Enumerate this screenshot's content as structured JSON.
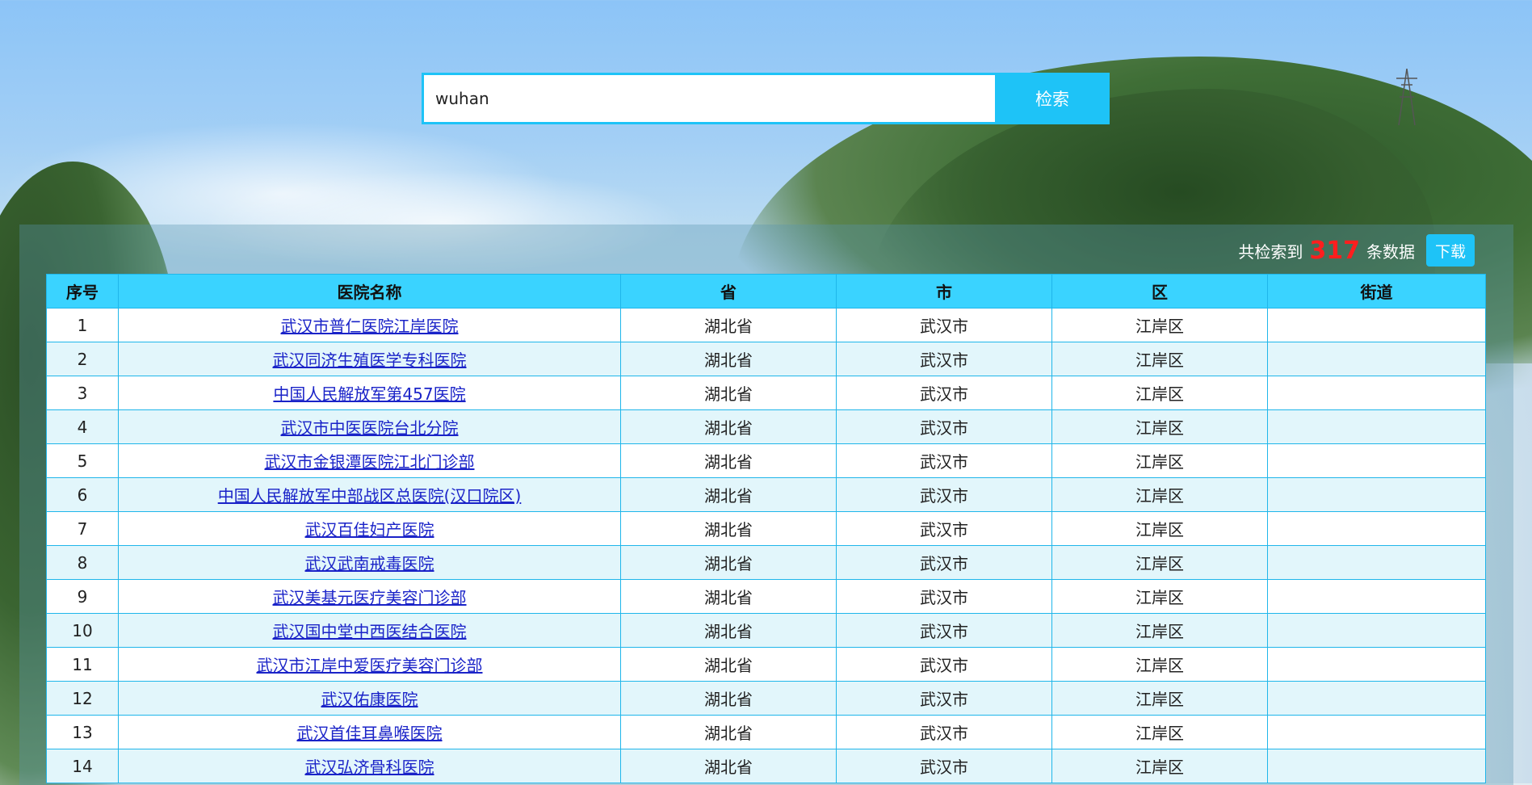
{
  "search": {
    "value": "wuhan",
    "button_label": "检索"
  },
  "summary": {
    "prefix": "共检索到",
    "count": "317",
    "suffix": "条数据",
    "download_label": "下载"
  },
  "table": {
    "headers": [
      "序号",
      "医院名称",
      "省",
      "市",
      "区",
      "街道"
    ],
    "rows": [
      [
        "1",
        "武汉市普仁医院江岸医院",
        "湖北省",
        "武汉市",
        "江岸区",
        ""
      ],
      [
        "2",
        "武汉同济生殖医学专科医院",
        "湖北省",
        "武汉市",
        "江岸区",
        ""
      ],
      [
        "3",
        "中国人民解放军第457医院",
        "湖北省",
        "武汉市",
        "江岸区",
        ""
      ],
      [
        "4",
        "武汉市中医医院台北分院",
        "湖北省",
        "武汉市",
        "江岸区",
        ""
      ],
      [
        "5",
        "武汉市金银潭医院江北门诊部",
        "湖北省",
        "武汉市",
        "江岸区",
        ""
      ],
      [
        "6",
        "中国人民解放军中部战区总医院(汉口院区)",
        "湖北省",
        "武汉市",
        "江岸区",
        ""
      ],
      [
        "7",
        "武汉百佳妇产医院",
        "湖北省",
        "武汉市",
        "江岸区",
        ""
      ],
      [
        "8",
        "武汉武南戒毒医院",
        "湖北省",
        "武汉市",
        "江岸区",
        ""
      ],
      [
        "9",
        "武汉美基元医疗美容门诊部",
        "湖北省",
        "武汉市",
        "江岸区",
        ""
      ],
      [
        "10",
        "武汉国中堂中西医结合医院",
        "湖北省",
        "武汉市",
        "江岸区",
        ""
      ],
      [
        "11",
        "武汉市江岸中爱医疗美容门诊部",
        "湖北省",
        "武汉市",
        "江岸区",
        ""
      ],
      [
        "12",
        "武汉佑康医院",
        "湖北省",
        "武汉市",
        "江岸区",
        ""
      ],
      [
        "13",
        "武汉首佳耳鼻喉医院",
        "湖北省",
        "武汉市",
        "江岸区",
        ""
      ],
      [
        "14",
        "武汉弘济骨科医院",
        "湖北省",
        "武汉市",
        "江岸区",
        ""
      ]
    ]
  }
}
